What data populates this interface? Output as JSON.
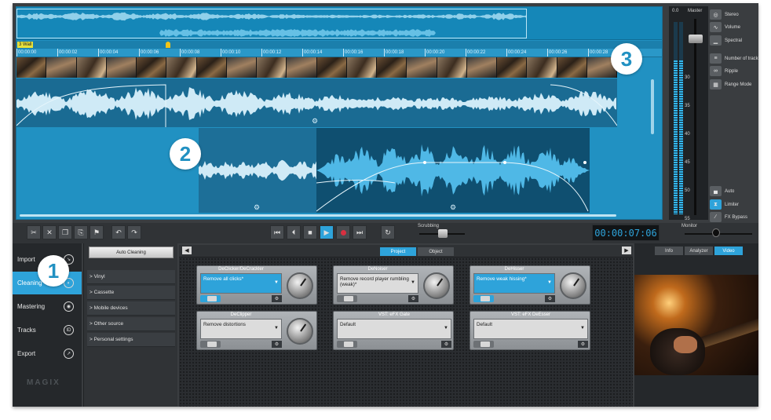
{
  "arranger": {
    "marker_label": "3 Wall",
    "ruler_ticks": [
      "00:00:00",
      "00:00:02",
      "00:00:04",
      "00:00:06",
      "00:00:08",
      "00:00:10",
      "00:00:12",
      "00:00:14",
      "00:00:16",
      "00:00:18",
      "00:00:20",
      "00:00:22",
      "00:00:24",
      "00:00:26",
      "00:00:28"
    ],
    "video_frame_count": 20,
    "fx_icon": "gear-icon"
  },
  "master": {
    "level_value": "0.0",
    "label": "Master",
    "scale_labels": [
      "30",
      "35",
      "40",
      "45",
      "50",
      "55"
    ]
  },
  "side_buttons": [
    {
      "label": "Stereo",
      "icon": "stereo-icon"
    },
    {
      "label": "Volume",
      "icon": "volume-icon"
    },
    {
      "label": "Spectral",
      "icon": "spectral-icon"
    },
    {
      "label": "Number of tracks",
      "icon": "tracks-icon"
    },
    {
      "label": "Ripple",
      "icon": "ripple-icon"
    },
    {
      "label": "Range Mode",
      "icon": "range-mode-icon"
    },
    {
      "label": "Auto",
      "icon": "auto-icon"
    },
    {
      "label": "Limiter",
      "icon": "limiter-icon",
      "active": true
    },
    {
      "label": "FX Bypass",
      "icon": "fx-bypass-icon"
    }
  ],
  "transport": {
    "edit_tools": [
      "cut-icon",
      "delete-icon",
      "copy-icon",
      "paste-icon",
      "flag-icon",
      "undo-icon",
      "redo-icon"
    ],
    "controls": [
      "skip-start-icon",
      "previous-icon",
      "stop-icon",
      "play-icon",
      "record-icon",
      "skip-end-icon",
      "loop-icon"
    ],
    "scrubbing_label": "Scrubbing",
    "time": "00:00:07:06",
    "monitor_label": "Monitor"
  },
  "sidebar": {
    "items": [
      {
        "label": "Import",
        "icon": "import-icon"
      },
      {
        "label": "Cleaning",
        "icon": "cleaning-icon",
        "active": true
      },
      {
        "label": "Mastering",
        "icon": "mastering-icon"
      },
      {
        "label": "Tracks",
        "icon": "tracks-id-icon"
      },
      {
        "label": "Export",
        "icon": "export-icon"
      }
    ],
    "logo": "MAGIX"
  },
  "categories": {
    "button": "Auto Cleaning",
    "items": [
      "> Vinyl",
      "> Cassette",
      "> Mobile devices",
      "> Other source",
      "> Personal settings"
    ]
  },
  "rack": {
    "tabs": [
      "Project",
      "Object"
    ],
    "active_tab": "Project",
    "modules": [
      {
        "name": "DeClicker/DeCrackler",
        "preset": "Remove all clicks*",
        "on": true,
        "has_knob": true
      },
      {
        "name": "DeNoiser",
        "preset": "Remove record player rumbling (weak)*",
        "on": false,
        "has_knob": true
      },
      {
        "name": "DeHisser",
        "preset": "Remove weak hissing*",
        "on": true,
        "has_knob": true
      },
      {
        "name": "DeClipper",
        "preset": "Remove distortions",
        "on": false,
        "has_knob": true
      },
      {
        "name": "VST: eFX Gate",
        "preset": "Default",
        "on": false,
        "has_knob": false
      },
      {
        "name": "VST: eFX DeEsser",
        "preset": "Default",
        "on": false,
        "has_knob": false
      }
    ]
  },
  "inspector": {
    "tabs": [
      "Info",
      "Analyzer",
      "Video"
    ],
    "active_tab": "Video"
  },
  "callouts": [
    "1",
    "2",
    "3"
  ],
  "colors": {
    "accent": "#2ea3da",
    "arranger": "#2191c2",
    "panel": "#3a3d40"
  }
}
